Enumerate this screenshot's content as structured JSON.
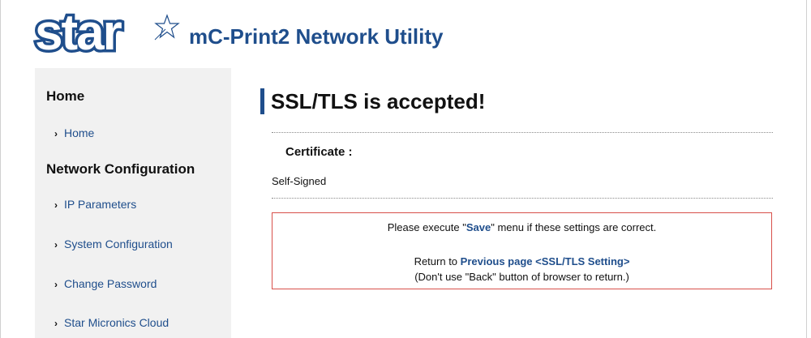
{
  "header": {
    "logo_text": "star",
    "app_title": "mC-Print2 Network Utility"
  },
  "colors": {
    "brand_blue": "#1f4e8c",
    "notice_border": "#d8504a",
    "sidebar_bg": "#f1f1f1"
  },
  "sidebar": {
    "sections": [
      {
        "heading": "Home",
        "items": [
          {
            "label": "Home",
            "icon": "chevron-right-icon"
          }
        ]
      },
      {
        "heading": "Network Configuration",
        "items": [
          {
            "label": "IP Parameters",
            "icon": "chevron-right-icon"
          },
          {
            "label": "System Configuration",
            "icon": "chevron-right-icon"
          },
          {
            "label": "Change Password",
            "icon": "chevron-right-icon"
          },
          {
            "label": "Star Micronics Cloud",
            "icon": "chevron-right-icon"
          }
        ]
      }
    ]
  },
  "main": {
    "page_title": "SSL/TLS is accepted!",
    "certificate_label": "Certificate :",
    "certificate_value": "Self-Signed",
    "notice": {
      "line1_prefix": "Please execute \"",
      "line1_emphasis": "Save",
      "line1_suffix": "\" menu if these settings are correct.",
      "line2_prefix": "Return to ",
      "line2_link": "Previous page <SSL/TLS Setting>",
      "line3": "(Don't use \"Back\" button of browser to return.)"
    }
  }
}
